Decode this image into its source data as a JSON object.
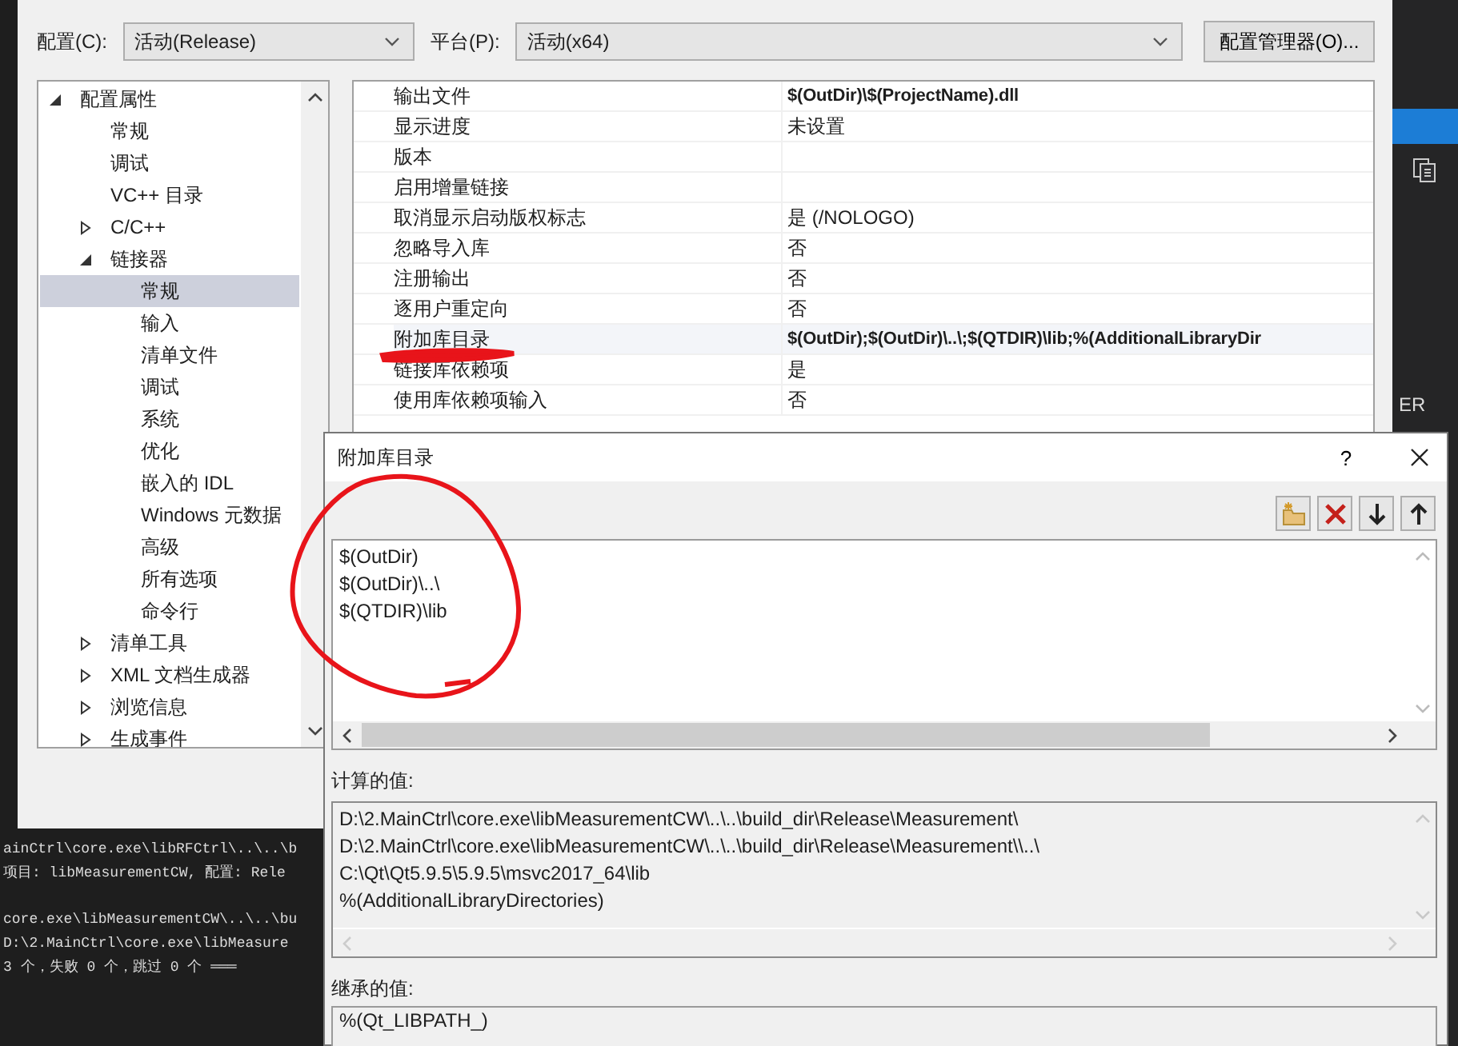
{
  "config_bar": {
    "config_label": "配置(C):",
    "config_value": "活动(Release)",
    "platform_label": "平台(P):",
    "platform_value": "活动(x64)",
    "manager_button": "配置管理器(O)..."
  },
  "tree": [
    {
      "label": "配置属性",
      "kind": "group",
      "expanded": true,
      "selected": false,
      "children": [
        {
          "label": "常规",
          "kind": "leaf",
          "selected": false
        },
        {
          "label": "调试",
          "kind": "leaf",
          "selected": false
        },
        {
          "label": "VC++ 目录",
          "kind": "leaf",
          "selected": false
        },
        {
          "label": "C/C++",
          "kind": "group",
          "expanded": false,
          "selected": false
        },
        {
          "label": "链接器",
          "kind": "group",
          "expanded": true,
          "selected": false,
          "children": [
            {
              "label": "常规",
              "kind": "leaf",
              "selected": true
            },
            {
              "label": "输入",
              "kind": "leaf",
              "selected": false
            },
            {
              "label": "清单文件",
              "kind": "leaf",
              "selected": false
            },
            {
              "label": "调试",
              "kind": "leaf",
              "selected": false
            },
            {
              "label": "系统",
              "kind": "leaf",
              "selected": false
            },
            {
              "label": "优化",
              "kind": "leaf",
              "selected": false
            },
            {
              "label": "嵌入的 IDL",
              "kind": "leaf",
              "selected": false
            },
            {
              "label": "Windows 元数据",
              "kind": "leaf",
              "selected": false
            },
            {
              "label": "高级",
              "kind": "leaf",
              "selected": false
            },
            {
              "label": "所有选项",
              "kind": "leaf",
              "selected": false
            },
            {
              "label": "命令行",
              "kind": "leaf",
              "selected": false
            }
          ]
        },
        {
          "label": "清单工具",
          "kind": "group",
          "expanded": false,
          "selected": false
        },
        {
          "label": "XML 文档生成器",
          "kind": "group",
          "expanded": false,
          "selected": false
        },
        {
          "label": "浏览信息",
          "kind": "group",
          "expanded": false,
          "selected": false
        },
        {
          "label": "生成事件",
          "kind": "group",
          "expanded": false,
          "selected": false
        }
      ]
    }
  ],
  "properties": [
    {
      "name": "输出文件",
      "value": "$(OutDir)\\$(ProjectName).dll",
      "bold": true,
      "selected": false
    },
    {
      "name": "显示进度",
      "value": "未设置",
      "bold": false,
      "selected": false
    },
    {
      "name": "版本",
      "selected": false
    },
    {
      "name": "启用增量链接",
      "selected": false
    },
    {
      "name": "取消显示启动版权标志",
      "value": "是 (/NOLOGO)",
      "bold": false,
      "selected": false
    },
    {
      "name": "忽略导入库",
      "value": "否",
      "bold": false,
      "selected": false
    },
    {
      "name": "注册输出",
      "value": "否",
      "bold": false,
      "selected": false
    },
    {
      "name": "逐用户重定向",
      "value": "否",
      "bold": false,
      "selected": false
    },
    {
      "name": "附加库目录",
      "value": "$(OutDir);$(OutDir)\\..\\;$(QTDIR)\\lib;%(AdditionalLibraryDir",
      "bold": true,
      "selected": true
    },
    {
      "name": "链接库依赖项",
      "value": "是",
      "bold": false,
      "selected": false
    },
    {
      "name": "使用库依赖项输入",
      "value": "否",
      "bold": false,
      "selected": false
    }
  ],
  "output_lines": [
    "ainCtrl\\core.exe\\libRFCtrl\\..\\..\\b",
    "项目: libMeasurementCW, 配置: Rele",
    "core.exe\\libMeasurementCW\\..\\..\\bu",
    " D:\\2.MainCtrl\\core.exe\\libMeasure",
    " 3 个，失败 0 个，跳过 0 个 ═══"
  ],
  "side_text": "ER",
  "dialog": {
    "title": "附加库目录",
    "help_label": "?",
    "toolbar": [
      {
        "kind": "new-folder"
      },
      {
        "kind": "delete"
      },
      {
        "kind": "move-down"
      },
      {
        "kind": "move-up"
      }
    ],
    "entries": [
      "$(OutDir)",
      "$(OutDir)\\..\\",
      "$(QTDIR)\\lib"
    ],
    "computed_label": "计算的值:",
    "computed_values": [
      "D:\\2.MainCtrl\\core.exe\\libMeasurementCW\\..\\..\\build_dir\\Release\\Measurement\\",
      "D:\\2.MainCtrl\\core.exe\\libMeasurementCW\\..\\..\\build_dir\\Release\\Measurement\\\\..\\",
      "C:\\Qt\\Qt5.9.5\\5.9.5\\msvc2017_64\\lib",
      "%(AdditionalLibraryDirectories)"
    ],
    "inherited_label": "继承的值:",
    "inherited_values": [
      "%(Qt_LIBPATH_)"
    ]
  }
}
